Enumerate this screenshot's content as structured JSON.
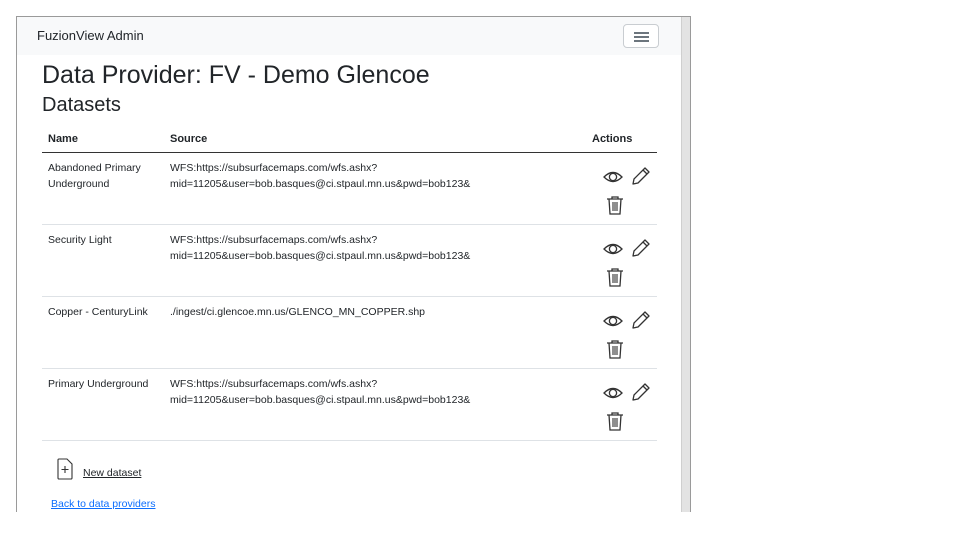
{
  "navbar": {
    "brand": "FuzionView Admin",
    "toggler_icon": "hamburger-menu-icon"
  },
  "page": {
    "title": "Data Provider: FV - Demo Glencoe",
    "subtitle": "Datasets"
  },
  "table": {
    "headers": [
      "Name",
      "Source",
      "Actions"
    ],
    "rows": [
      {
        "name": "Abandoned Primary Underground",
        "source": "WFS:https://subsurfacemaps.com/wfs.ashx?mid=11205&user=bob.basques@ci.stpaul.mn.us&pwd=bob123&"
      },
      {
        "name": "Security Light",
        "source": "WFS:https://subsurfacemaps.com/wfs.ashx?mid=11205&user=bob.basques@ci.stpaul.mn.us&pwd=bob123&"
      },
      {
        "name": "Copper - CenturyLink",
        "source": "./ingest/ci.glencoe.mn.us/GLENCO_MN_COPPER.shp"
      },
      {
        "name": "Primary Underground",
        "source": "WFS:https://subsurfacemaps.com/wfs.ashx?mid=11205&user=bob.basques@ci.stpaul.mn.us&pwd=bob123&"
      }
    ],
    "action_icons": [
      "view-eye-icon",
      "edit-pencil-icon",
      "delete-trash-icon"
    ]
  },
  "new_dataset": {
    "label": "New dataset",
    "icon": "file-plus-icon"
  },
  "back_link": "Back to data providers"
}
